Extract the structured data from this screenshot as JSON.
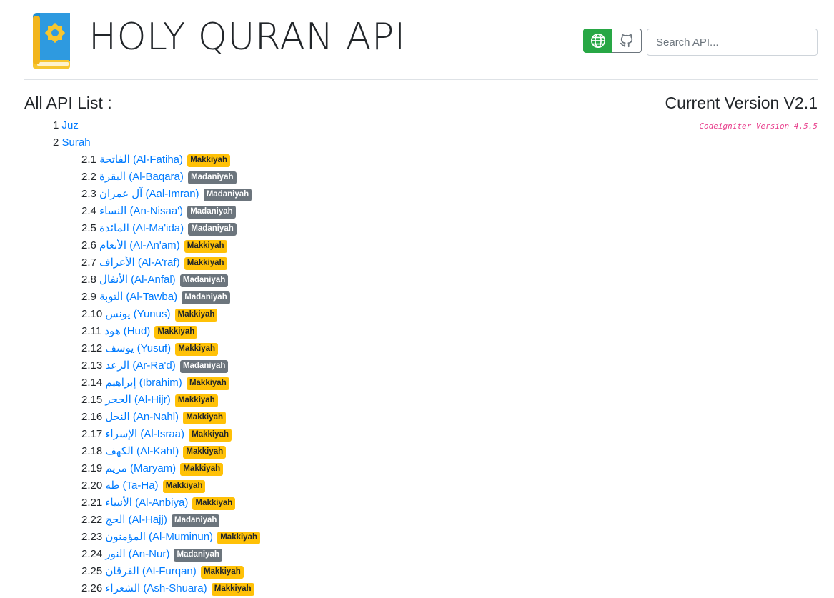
{
  "header": {
    "title": "HOLY QURAN API",
    "search_placeholder": "Search API...",
    "globe_button_icon": "globe-icon",
    "github_button_icon": "github-icon",
    "colors": {
      "globe_button": "#28a745",
      "link": "#007bff",
      "makkiyah": "#ffc107",
      "madaniyah": "#6c757d"
    }
  },
  "api_list": {
    "heading": "All API List :",
    "items": [
      {
        "num": "1",
        "label": "Juz"
      },
      {
        "num": "2",
        "label": "Surah"
      }
    ]
  },
  "version": {
    "heading": "Current Version V2.1",
    "framework": "Codeigniter Version 4.5.5"
  },
  "surahs": [
    {
      "num": "2.1",
      "label": "الفاتحة (Al-Fatiha)",
      "type": "Makkiyah"
    },
    {
      "num": "2.2",
      "label": "البقرة (Al-Baqara)",
      "type": "Madaniyah"
    },
    {
      "num": "2.3",
      "label": "آل عمران (Aal-Imran)",
      "type": "Madaniyah"
    },
    {
      "num": "2.4",
      "label": "النساء (An-Nisaa')",
      "type": "Madaniyah"
    },
    {
      "num": "2.5",
      "label": "المائدة (Al-Ma'ida)",
      "type": "Madaniyah"
    },
    {
      "num": "2.6",
      "label": "الأنعام (Al-An'am)",
      "type": "Makkiyah"
    },
    {
      "num": "2.7",
      "label": "الأعراف (Al-A'raf)",
      "type": "Makkiyah"
    },
    {
      "num": "2.8",
      "label": "الأنفال (Al-Anfal)",
      "type": "Madaniyah"
    },
    {
      "num": "2.9",
      "label": "التوبة (Al-Tawba)",
      "type": "Madaniyah"
    },
    {
      "num": "2.10",
      "label": "يونس (Yunus)",
      "type": "Makkiyah"
    },
    {
      "num": "2.11",
      "label": "هود (Hud)",
      "type": "Makkiyah"
    },
    {
      "num": "2.12",
      "label": "يوسف (Yusuf)",
      "type": "Makkiyah"
    },
    {
      "num": "2.13",
      "label": "الرعد (Ar-Ra'd)",
      "type": "Madaniyah"
    },
    {
      "num": "2.14",
      "label": "إبراهيم (Ibrahim)",
      "type": "Makkiyah"
    },
    {
      "num": "2.15",
      "label": "الحجر (Al-Hijr)",
      "type": "Makkiyah"
    },
    {
      "num": "2.16",
      "label": "النحل (An-Nahl)",
      "type": "Makkiyah"
    },
    {
      "num": "2.17",
      "label": "الإسراء (Al-Israa)",
      "type": "Makkiyah"
    },
    {
      "num": "2.18",
      "label": "الكهف (Al-Kahf)",
      "type": "Makkiyah"
    },
    {
      "num": "2.19",
      "label": "مريم (Maryam)",
      "type": "Makkiyah"
    },
    {
      "num": "2.20",
      "label": "طه (Ta-Ha)",
      "type": "Makkiyah"
    },
    {
      "num": "2.21",
      "label": "الأنبياء (Al-Anbiya)",
      "type": "Makkiyah"
    },
    {
      "num": "2.22",
      "label": "الحج (Al-Hajj)",
      "type": "Madaniyah"
    },
    {
      "num": "2.23",
      "label": "المؤمنون (Al-Muminun)",
      "type": "Makkiyah"
    },
    {
      "num": "2.24",
      "label": "النور (An-Nur)",
      "type": "Madaniyah"
    },
    {
      "num": "2.25",
      "label": "الفرقان (Al-Furqan)",
      "type": "Makkiyah"
    },
    {
      "num": "2.26",
      "label": "الشعراء (Ash-Shuara)",
      "type": "Makkiyah"
    }
  ]
}
